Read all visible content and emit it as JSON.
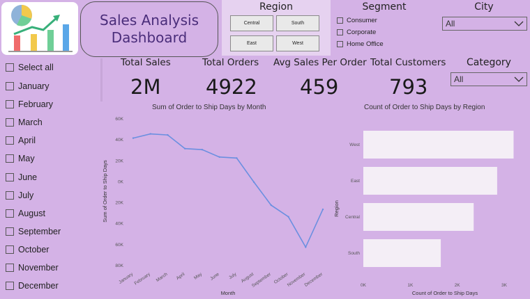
{
  "header": {
    "title_line1": "Sales Analysis",
    "title_line2": "Dashboard"
  },
  "region": {
    "title": "Region",
    "tiles": [
      "Central",
      "South",
      "East",
      "West"
    ]
  },
  "segment": {
    "title": "Segment",
    "items": [
      "Consumer",
      "Corporate",
      "Home Office"
    ]
  },
  "city": {
    "title": "City",
    "selected": "All"
  },
  "category": {
    "title": "Category",
    "selected": "All"
  },
  "months": {
    "items": [
      "Select all",
      "January",
      "February",
      "March",
      "April",
      "May",
      "June",
      "July",
      "August",
      "September",
      "October",
      "November",
      "December"
    ]
  },
  "kpis": [
    {
      "label": "Total Sales",
      "value": "2M"
    },
    {
      "label": "Total Orders",
      "value": "4922"
    },
    {
      "label": "Avg Sales Per Order",
      "value": "459"
    },
    {
      "label": "Total Customers",
      "value": "793"
    }
  ],
  "icons": {
    "logo": "chart-logo-icon",
    "dropdown": "chevron-down-icon"
  },
  "colors": {
    "background": "#d4b2e6",
    "line": "#6b8fe0",
    "bar": "#f4eef6",
    "title_text": "#4a2d7a"
  },
  "chart_data": [
    {
      "type": "line",
      "title": "Sum of Order to Ship Days by Month",
      "xlabel": "Month",
      "ylabel": "Sum of Order to Ship Days",
      "categories": [
        "January",
        "February",
        "March",
        "April",
        "May",
        "June",
        "July",
        "August",
        "September",
        "October",
        "November",
        "December"
      ],
      "values": [
        41000,
        45000,
        44000,
        31000,
        30000,
        23000,
        22000,
        -1000,
        -23000,
        -34000,
        -63000,
        -27000
      ],
      "yticks": [
        "60K",
        "40K",
        "20K",
        "0K",
        "20K",
        "40K",
        "60K",
        "80K"
      ],
      "ylim": [
        -80000,
        60000
      ],
      "grid": false
    },
    {
      "type": "bar",
      "orientation": "horizontal",
      "title": "Count of Order to Ship Days by Region",
      "xlabel": "Count of Order to Ship Days",
      "ylabel": "Region",
      "categories": [
        "West",
        "East",
        "Central",
        "South"
      ],
      "values": [
        3200,
        2850,
        2350,
        1650
      ],
      "xticks": [
        "0K",
        "1K",
        "2K",
        "3K"
      ],
      "xlim": [
        0,
        3000
      ]
    }
  ]
}
